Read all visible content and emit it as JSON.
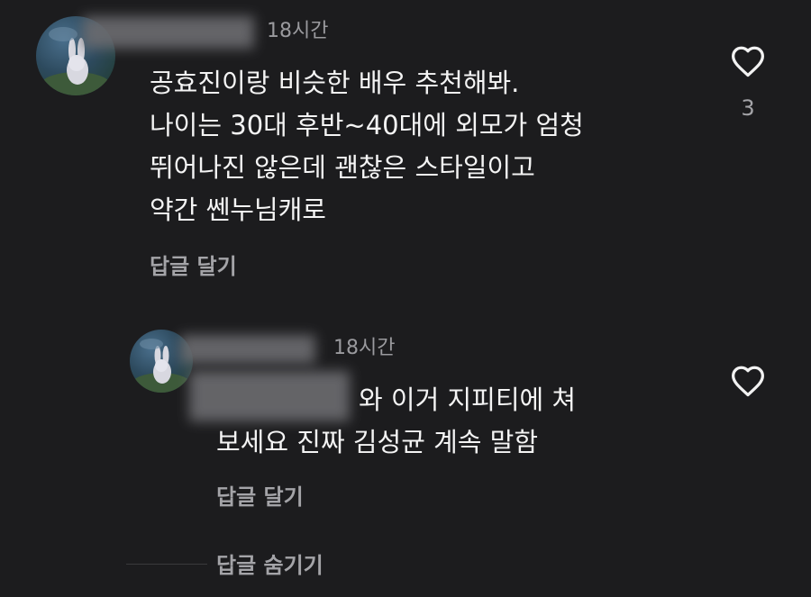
{
  "comment": {
    "time": "18시간",
    "lines": [
      "공효진이랑 비슷한 배우 추천해봐.",
      "나이는 30대 후반~40대에 외모가 엄청",
      "뛰어나진 않은데 괜찮은 스타일이고",
      "약간 쎈누님캐로"
    ],
    "reply_label": "답글 달기",
    "like_count": "3"
  },
  "reply": {
    "time": "18시간",
    "lines": [
      "와 이거 지피티에 쳐",
      "보세요 진짜 김성균 계속 말함"
    ],
    "reply_label": "답글 달기"
  },
  "hide_replies_label": "답글 숨기기",
  "icons": {
    "like": "heart-outline-icon",
    "avatar": "avatar-image"
  }
}
